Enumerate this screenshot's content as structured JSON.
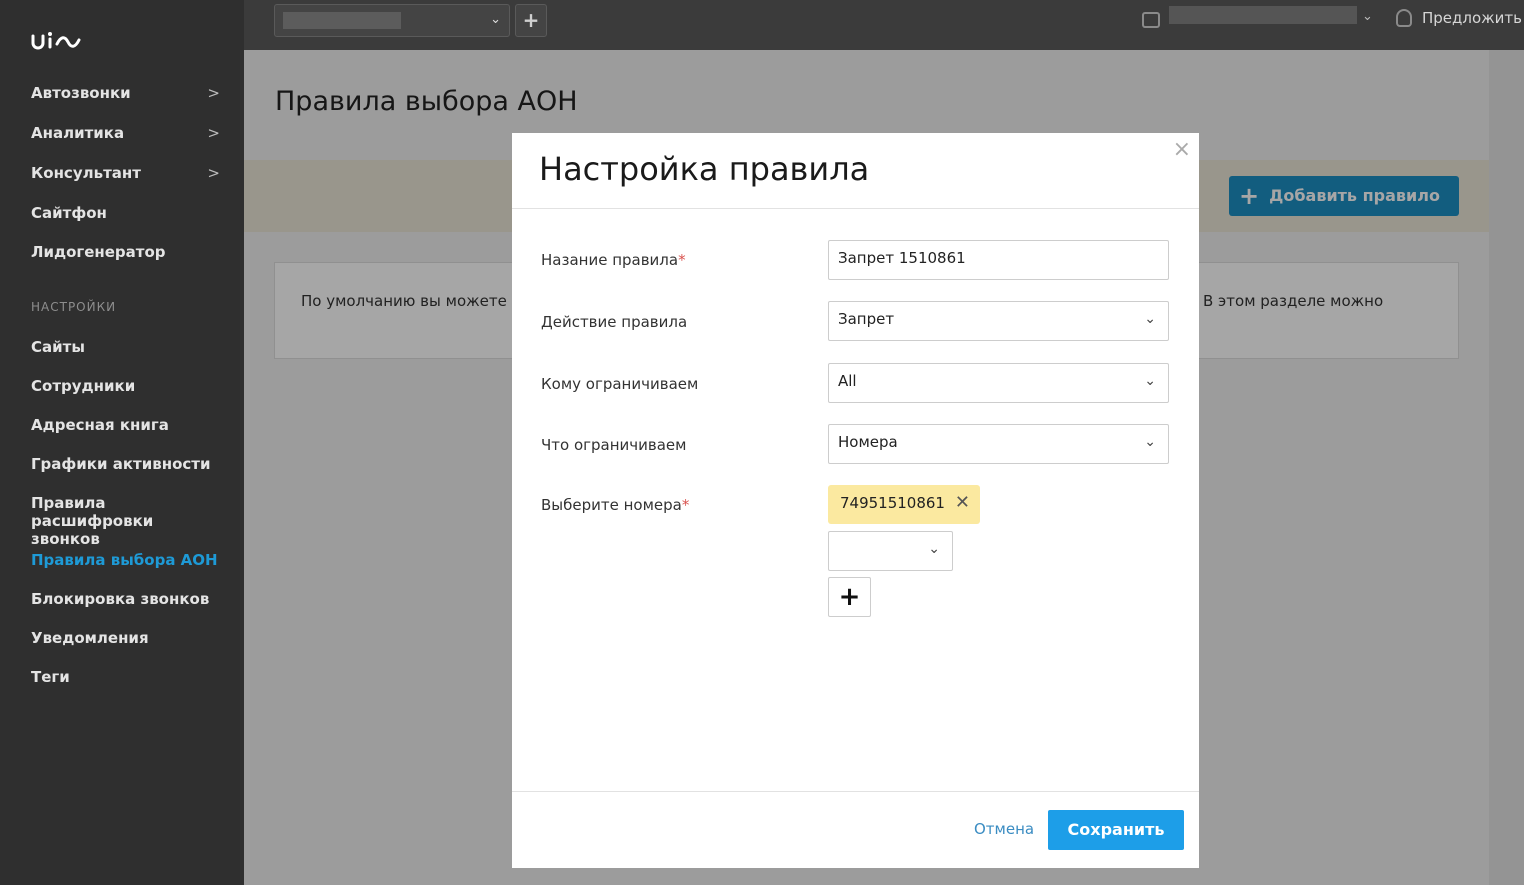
{
  "sidebar": {
    "items": [
      {
        "label": "Автозвонки",
        "chevron": ">"
      },
      {
        "label": "Аналитика",
        "chevron": ">"
      },
      {
        "label": "Консультант",
        "chevron": ">"
      },
      {
        "label": "Сайтфон"
      },
      {
        "label": "Лидогенератор"
      }
    ],
    "section_title": "НАСТРОЙКИ",
    "settings_items": [
      {
        "label": "Сайты"
      },
      {
        "label": "Сотрудники"
      },
      {
        "label": "Адресная книга"
      },
      {
        "label": "Графики активности"
      },
      {
        "label": "Правила расшифровки звонков"
      },
      {
        "label": "Правила выбора АОН",
        "active": true
      },
      {
        "label": "Блокировка звонков"
      },
      {
        "label": "Уведомления"
      },
      {
        "label": "Теги"
      }
    ]
  },
  "topbar": {
    "suggest_label": "Предложить",
    "icons": [
      "wallet-icon",
      "bulb-icon",
      "plus-icon",
      "chevron-down-icon"
    ]
  },
  "page": {
    "title": "Правила выбора АОН",
    "add_button_label": "Добавить правило",
    "info_left": "По умолчанию вы можете задать ограничения подст",
    "info_right": "В этом разделе можно"
  },
  "modal": {
    "title": "Настройка правила",
    "close": "×",
    "fields": {
      "rule_name": {
        "label": "Назание правила",
        "value": "Запрет 1510861"
      },
      "action": {
        "label": "Действие правила",
        "value": "Запрет"
      },
      "whom": {
        "label": "Кому ограничиваем",
        "value": "All"
      },
      "what": {
        "label": "Что ограничиваем",
        "value": "Номера"
      },
      "numbers": {
        "label": "Выберите номера",
        "tag": "74951510861"
      }
    },
    "cancel_label": "Отмена",
    "save_label": "Сохранить"
  },
  "colors": {
    "accent": "#1d9ee8",
    "active_nav": "#1e9ad6",
    "tag_bg": "#fbe9a0",
    "sidebar_bg": "#2f2f2f"
  }
}
